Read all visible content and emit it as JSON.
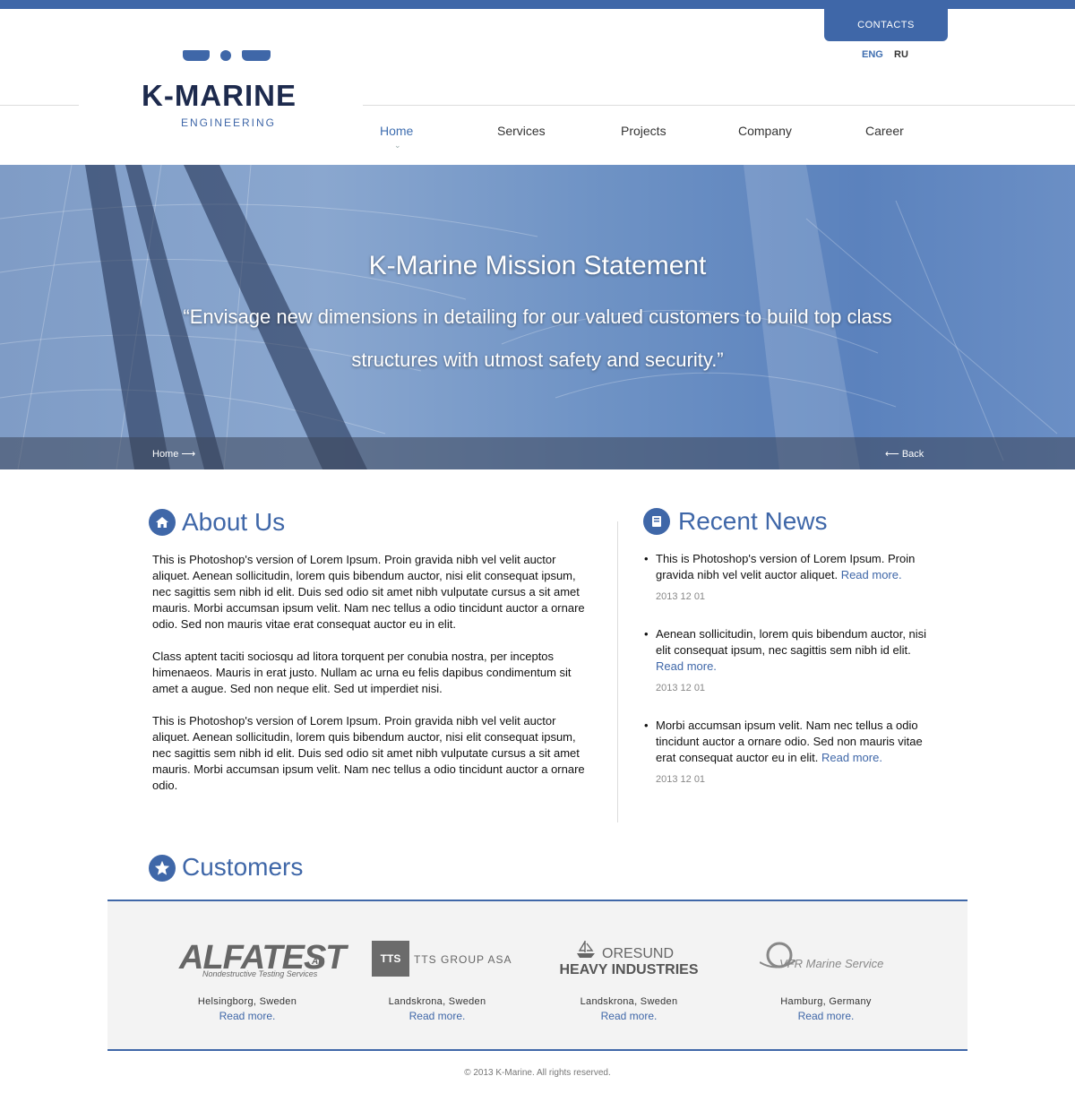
{
  "header": {
    "contacts_label": "CONTACTS",
    "lang_eng": "ENG",
    "lang_ru": "RU",
    "logo_name": "K-MARINE",
    "logo_sub": "ENGINEERING"
  },
  "nav": {
    "home": "Home",
    "services": "Services",
    "projects": "Projects",
    "company": "Company",
    "career": "Career",
    "active": "Home"
  },
  "hero": {
    "title": "K-Marine Mission Statement",
    "quote": "“Envisage new dimensions in detailing for our valued customers to build top class structures with utmost safety and security.”",
    "crumb": "Home",
    "back": "Back"
  },
  "about": {
    "title": "About Us",
    "paragraphs": [
      "This is Photoshop's version  of Lorem Ipsum. Proin gravida nibh vel velit auctor aliquet. Aenean sollicitudin, lorem quis bibendum auctor, nisi elit consequat ipsum, nec sagittis sem nibh id elit. Duis sed odio sit amet nibh vulputate cursus a sit amet mauris. Morbi accumsan ipsum velit. Nam nec tellus a odio tincidunt auctor a ornare odio. Sed non  mauris vitae erat consequat auctor eu in elit.",
      "Class aptent taciti sociosqu ad litora torquent per conubia nostra, per inceptos himenaeos. Mauris in erat justo. Nullam ac urna eu felis dapibus condimentum sit amet a augue. Sed non neque elit. Sed ut imperdiet nisi.",
      "This is Photoshop's version  of Lorem Ipsum. Proin gravida nibh vel velit auctor aliquet. Aenean sollicitudin, lorem quis bibendum auctor, nisi elit consequat ipsum, nec sagittis sem nibh id elit. Duis sed odio sit amet nibh vulputate cursus a sit amet mauris. Morbi accumsan ipsum velit. Nam nec tellus a odio tincidunt auctor a ornare odio."
    ]
  },
  "news": {
    "title": "Recent News",
    "items": [
      {
        "text": "This is Photoshop's version  of Lorem Ipsum. Proin gravida nibh vel velit auctor aliquet.",
        "link": "Read more.",
        "date": "2013 12 01"
      },
      {
        "text": "Aenean sollicitudin, lorem quis bibendum auctor, nisi elit consequat ipsum, nec sagittis sem nibh id elit.",
        "link": "Read more.",
        "date": "2013 12 01"
      },
      {
        "text": "Morbi accumsan ipsum velit. Nam nec tellus a odio tincidunt auctor a ornare odio. Sed non  mauris vitae erat consequat auctor eu in elit.",
        "link": "Read more.",
        "date": "2013 12 01"
      }
    ]
  },
  "customers": {
    "title": "Customers",
    "items": [
      {
        "logo_main": "ALFATEST",
        "logo_suffix": "AB",
        "logo_tag": "Nondestructive Testing Services",
        "location": "Helsingborg, Sweden",
        "link": "Read more."
      },
      {
        "logo_mark": "TTS",
        "logo_main": "TTS GROUP ASA",
        "location": "Landskrona, Sweden",
        "link": "Read more."
      },
      {
        "logo_main": "ORESUND",
        "logo_tag": "HEAVY INDUSTRIES",
        "location": "Landskrona, Sweden",
        "link": "Read more."
      },
      {
        "logo_main": "VFR",
        "logo_tag": "Marine Service",
        "location": "Hamburg, Germany",
        "link": "Read more."
      }
    ]
  },
  "footer": {
    "copyright": "© 2013 K-Marine. All rights reserved."
  },
  "colors": {
    "accent": "#3f67a8",
    "logo_text": "#1d2a4d",
    "panel_bg": "#f3f3f3"
  },
  "icons": {
    "about": "home-icon",
    "news": "book-icon",
    "customers": "star-icon"
  }
}
